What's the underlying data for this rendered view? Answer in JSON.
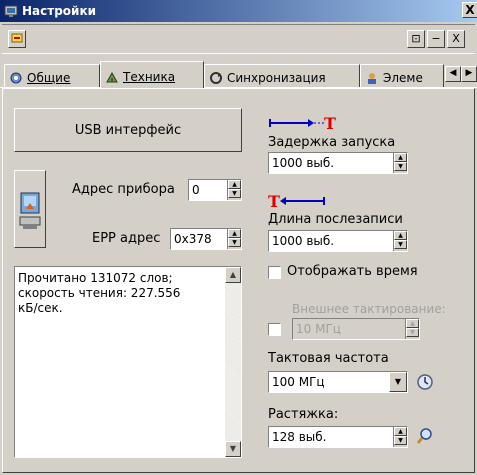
{
  "window": {
    "title": "Настройки",
    "close_label": "X"
  },
  "toolbar": {
    "restore_label": "⊡",
    "minimize_label": "−",
    "close_label": "X"
  },
  "tabs": [
    {
      "label": "Общие",
      "icon": "gear-icon"
    },
    {
      "label": "Техника",
      "icon": "hardware-icon"
    },
    {
      "label": "Синхронизация",
      "icon": "sync-icon"
    },
    {
      "label": "Элеме",
      "icon": "element-icon"
    }
  ],
  "left": {
    "usb_button": "USB интерфейс",
    "address_label": "Адрес прибора",
    "address_value": "0",
    "epp_label": "EPP адрес",
    "epp_value": "0x378",
    "info_text": "Прочитано 131072 слов;\nскорость чтения: 227.556\nкБ/сек."
  },
  "right": {
    "delay_label": "Задержка запуска",
    "delay_value": "1000 выб.",
    "post_label": "Длина послезаписи",
    "post_value": "1000 выб.",
    "show_time_label": "Отображать время",
    "show_time_checked": false,
    "ext_clock_label": "Внешнее тактирование:",
    "ext_clock_value": "10 МГц",
    "ext_clock_checked": false,
    "clock_label": "Тактовая частота",
    "clock_value": "100 МГц",
    "stretch_label": "Растяжка:",
    "stretch_value": "128 выб."
  },
  "marker_letter": "T",
  "colors": {
    "title_start": "#0a246a",
    "title_end": "#a6caf0",
    "marker_blue": "#0000c0",
    "marker_red": "#e00000"
  }
}
